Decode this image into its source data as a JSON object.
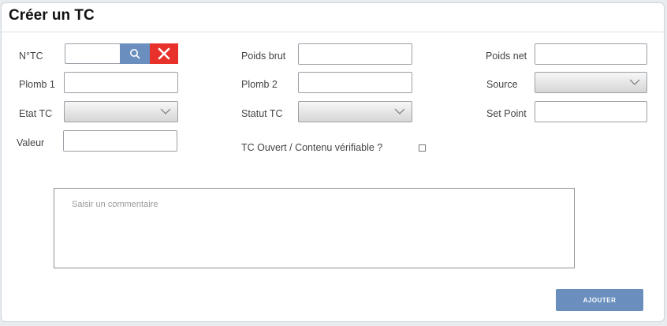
{
  "dialog": {
    "title": "Créer un TC"
  },
  "form": {
    "ntc": {
      "label": "N°TC",
      "value": ""
    },
    "poids_brut": {
      "label": "Poids brut",
      "value": ""
    },
    "poids_net": {
      "label": "Poids net",
      "value": ""
    },
    "plomb1": {
      "label": "Plomb 1",
      "value": ""
    },
    "plomb2": {
      "label": "Plomb 2",
      "value": ""
    },
    "source": {
      "label": "Source",
      "selected": ""
    },
    "etat_tc": {
      "label": "Etat TC",
      "selected": ""
    },
    "statut_tc": {
      "label": "Statut TC",
      "selected": ""
    },
    "set_point": {
      "label": "Set Point",
      "value": ""
    },
    "valeur": {
      "label": "Valeur",
      "value": ""
    },
    "tc_ouvert": {
      "label": "TC Ouvert / Contenu vérifiable ?",
      "checked": false
    },
    "comment": {
      "placeholder": "Saisir un commentaire",
      "value": ""
    }
  },
  "actions": {
    "add_label": "AJOUTER"
  },
  "colors": {
    "primary": "#6a8fbf",
    "danger": "#e8312b"
  },
  "icons": {
    "search": "search-icon",
    "clear": "close-icon",
    "dropdown": "chevron-down-icon"
  }
}
